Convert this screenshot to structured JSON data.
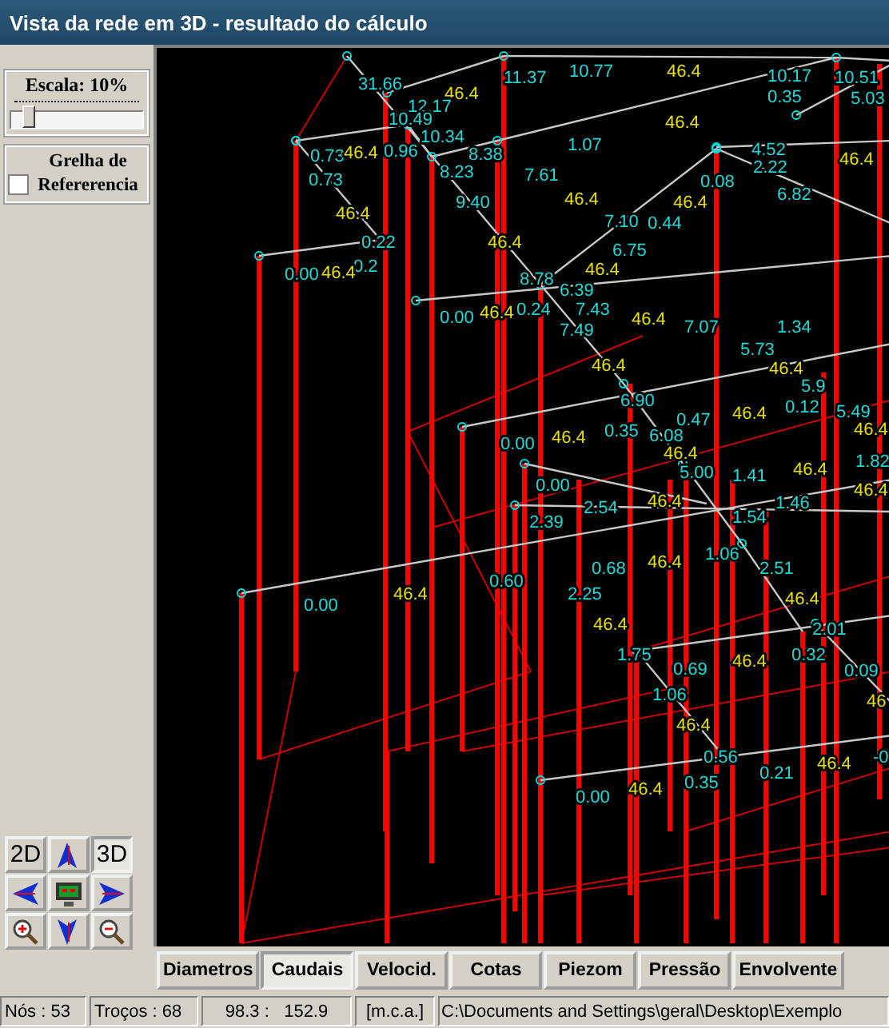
{
  "window": {
    "title": "Vista da rede em 3D - resultado do cálculo"
  },
  "scale": {
    "label": "Escala: 10%",
    "level": 0.1
  },
  "grid_toggle": {
    "label": "Grelha de Refererencia",
    "checked": false
  },
  "view_buttons": [
    {
      "kind": "flat",
      "label": "2D",
      "selected": false
    },
    {
      "kind": "up",
      "selected": false
    },
    {
      "kind": "perspective",
      "label": "3D",
      "selected": true
    },
    {
      "kind": "left",
      "selected": false
    },
    {
      "kind": "fit",
      "selected": false
    },
    {
      "kind": "right",
      "selected": false
    },
    {
      "kind": "zoom-in",
      "selected": false
    },
    {
      "kind": "down",
      "selected": false
    },
    {
      "kind": "zoom-out",
      "selected": false
    }
  ],
  "network_view": {
    "labels": [
      {
        "text": "31.66",
        "kind": "value"
      },
      {
        "text": "46.4",
        "kind": "diameter"
      },
      {
        "text": "11.37",
        "kind": "value"
      },
      {
        "text": "10.77",
        "kind": "value"
      },
      {
        "text": "46.4",
        "kind": "diameter"
      },
      {
        "text": "10.17",
        "kind": "value"
      },
      {
        "text": "0.35",
        "kind": "value"
      },
      {
        "text": "10.51",
        "kind": "value"
      },
      {
        "text": "5.03",
        "kind": "value"
      },
      {
        "text": "12.17",
        "kind": "value"
      },
      {
        "text": "10.49",
        "kind": "value"
      },
      {
        "text": "46.4",
        "kind": "diameter"
      },
      {
        "text": "10.34",
        "kind": "value"
      },
      {
        "text": "0.73",
        "kind": "value"
      },
      {
        "text": "46.4",
        "kind": "diameter"
      },
      {
        "text": "0.96",
        "kind": "value"
      },
      {
        "text": "8.38",
        "kind": "value"
      },
      {
        "text": "1.07",
        "kind": "value"
      },
      {
        "text": "4.52",
        "kind": "value"
      },
      {
        "text": "2.22",
        "kind": "value"
      },
      {
        "text": "46.4",
        "kind": "diameter"
      },
      {
        "text": "8.23",
        "kind": "value"
      },
      {
        "text": "0.73",
        "kind": "value"
      },
      {
        "text": "7.61",
        "kind": "value"
      },
      {
        "text": "0.08",
        "kind": "value"
      },
      {
        "text": "6.82",
        "kind": "value"
      },
      {
        "text": "9.40",
        "kind": "value"
      },
      {
        "text": "46.4",
        "kind": "diameter"
      },
      {
        "text": "46.4",
        "kind": "diameter"
      },
      {
        "text": "46.4",
        "kind": "diameter"
      },
      {
        "text": "7.10",
        "kind": "value"
      },
      {
        "text": "0.44",
        "kind": "value"
      },
      {
        "text": "0.22",
        "kind": "value"
      },
      {
        "text": "46.4",
        "kind": "diameter"
      },
      {
        "text": "6.75",
        "kind": "value"
      },
      {
        "text": "0.2",
        "kind": "value"
      },
      {
        "text": "0.00",
        "kind": "value"
      },
      {
        "text": "46.4",
        "kind": "diameter"
      },
      {
        "text": "46.4",
        "kind": "diameter"
      },
      {
        "text": "8.78",
        "kind": "value"
      },
      {
        "text": "6.39",
        "kind": "value"
      },
      {
        "text": "0.24",
        "kind": "value"
      },
      {
        "text": "0.00",
        "kind": "value"
      },
      {
        "text": "46.4",
        "kind": "diameter"
      },
      {
        "text": "7.43",
        "kind": "value"
      },
      {
        "text": "46.4",
        "kind": "diameter"
      },
      {
        "text": "7.49",
        "kind": "value"
      },
      {
        "text": "7.07",
        "kind": "value"
      },
      {
        "text": "1.34",
        "kind": "value"
      },
      {
        "text": "5.73",
        "kind": "value"
      },
      {
        "text": "46.4",
        "kind": "diameter"
      },
      {
        "text": "46.4",
        "kind": "diameter"
      },
      {
        "text": "5.9",
        "kind": "value"
      },
      {
        "text": "6.90",
        "kind": "value"
      },
      {
        "text": "0.47",
        "kind": "value"
      },
      {
        "text": "46.4",
        "kind": "diameter"
      },
      {
        "text": "0.12",
        "kind": "value"
      },
      {
        "text": "5.49",
        "kind": "value"
      },
      {
        "text": "0.35",
        "kind": "value"
      },
      {
        "text": "6.08",
        "kind": "value"
      },
      {
        "text": "46.4",
        "kind": "diameter"
      },
      {
        "text": "0.00",
        "kind": "value"
      },
      {
        "text": "46.4",
        "kind": "diameter"
      },
      {
        "text": "46.4",
        "kind": "diameter"
      },
      {
        "text": "1.82",
        "kind": "value"
      },
      {
        "text": "5.00",
        "kind": "value"
      },
      {
        "text": "1.41",
        "kind": "value"
      },
      {
        "text": "46.4",
        "kind": "diameter"
      },
      {
        "text": "0.00",
        "kind": "value"
      },
      {
        "text": "46.4",
        "kind": "diameter"
      },
      {
        "text": "2.54",
        "kind": "value"
      },
      {
        "text": "46.4",
        "kind": "diameter"
      },
      {
        "text": "1.46",
        "kind": "value"
      },
      {
        "text": "2.39",
        "kind": "value"
      },
      {
        "text": "1.54",
        "kind": "value"
      },
      {
        "text": "1.06",
        "kind": "value"
      },
      {
        "text": "0.68",
        "kind": "value"
      },
      {
        "text": "46.4",
        "kind": "diameter"
      },
      {
        "text": "2.51",
        "kind": "value"
      },
      {
        "text": "0.60",
        "kind": "value"
      },
      {
        "text": "46.4",
        "kind": "diameter"
      },
      {
        "text": "0.00",
        "kind": "value"
      },
      {
        "text": "46.4",
        "kind": "diameter"
      },
      {
        "text": "2.25",
        "kind": "value"
      },
      {
        "text": "46.4",
        "kind": "diameter"
      },
      {
        "text": "2.01",
        "kind": "value"
      },
      {
        "text": "1.75",
        "kind": "value"
      },
      {
        "text": "0.32",
        "kind": "value"
      },
      {
        "text": "46.4",
        "kind": "diameter"
      },
      {
        "text": "0.69",
        "kind": "value"
      },
      {
        "text": "0.09",
        "kind": "value"
      },
      {
        "text": "1.06",
        "kind": "value"
      },
      {
        "text": "46",
        "kind": "diameter"
      },
      {
        "text": "46.4",
        "kind": "diameter"
      },
      {
        "text": "0.56",
        "kind": "value"
      },
      {
        "text": "-0",
        "kind": "value"
      },
      {
        "text": "46.4",
        "kind": "diameter"
      },
      {
        "text": "0.21",
        "kind": "value"
      },
      {
        "text": "0.35",
        "kind": "value"
      },
      {
        "text": "46.4",
        "kind": "diameter"
      },
      {
        "text": "0.00",
        "kind": "value"
      }
    ]
  },
  "result_tabs": [
    {
      "label": "Diametros",
      "selected": false
    },
    {
      "label": "Caudais",
      "selected": true
    },
    {
      "label": "Velocid.",
      "selected": false
    },
    {
      "label": "Cotas",
      "selected": false
    },
    {
      "label": "Piezom",
      "selected": false
    },
    {
      "label": "Pressão",
      "selected": false
    },
    {
      "label": "Envolvente",
      "selected": false
    }
  ],
  "status_bar": {
    "nodes": "Nós : 53",
    "segments": "Troços : 68",
    "coordinates": "98.3 :   152.9",
    "units": "[m.c.a.]",
    "path": "C:\\Documents and Settings\\geral\\Desktop\\Exemplo"
  }
}
